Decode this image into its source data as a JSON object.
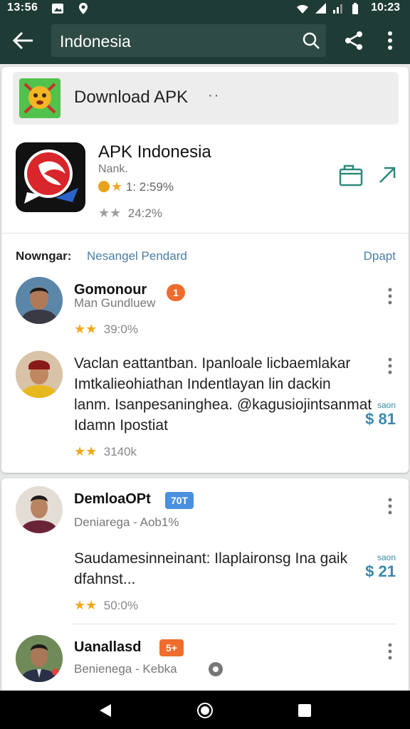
{
  "status_bar": {
    "time_left": "13:56",
    "time_right": "10:23",
    "icons": [
      "image-icon",
      "location-icon",
      "wifi-icon",
      "signal-icon",
      "battery-icon"
    ]
  },
  "app_bar": {
    "search_value": "Indonesia",
    "icons": [
      "back-arrow-icon",
      "search-icon",
      "share-icon",
      "more-vert-icon"
    ],
    "color": "#1f3b35"
  },
  "download_banner": {
    "label": "Download APK",
    "dots": "··"
  },
  "app": {
    "title": "APK Indonesia",
    "developer": "Nank.",
    "rating_line": "1: 2:59%",
    "downloads_line": "24:2%",
    "icons": [
      "open-app-icon",
      "send-icon"
    ]
  },
  "reviews_header": {
    "label": "Nowngar:",
    "link": "Nesangel Pendard",
    "right_link": "Dpapt"
  },
  "reviews": [
    {
      "name": "Gomonour",
      "sub": "Man Gundluew",
      "badge": "1",
      "badge_color": "#ef6c2c",
      "stars_text": "39:0%"
    },
    {
      "text_lines": [
        "Vaclan eattantban. Ipanloale licbaemlakar",
        "Imtkalieohiathan Indentlayan lin dackin",
        "lanm. Isanpesaninghea. @kagusiojintsanmat",
        "Idamn Ipostiat"
      ],
      "price_small": "saon",
      "price_value": "$ 81",
      "stars_text": "3140k"
    },
    {
      "name": "DemloaOPt",
      "sub": "Deniarega  -  Aob1%",
      "badge": "70T",
      "badge_color": "#4a8fe0",
      "text_lines": [
        "Saudamesinneinant: Ilaplaironsg Ina gaik",
        "dfahnst..."
      ],
      "price_small": "saon",
      "price_value": "$ 21",
      "stars_text": "50:0%"
    },
    {
      "name": "Uanallasd",
      "sub": "Benienega  -  Kebka",
      "badge": "5+",
      "badge_color": "#ef6c2c"
    }
  ],
  "nav_bar": {
    "icons": [
      "nav-back-icon",
      "nav-home-icon",
      "nav-recents-icon"
    ]
  },
  "colors": {
    "accent": "#2a8a7a",
    "link": "#4a7fa8",
    "star": "#f2a81c"
  }
}
